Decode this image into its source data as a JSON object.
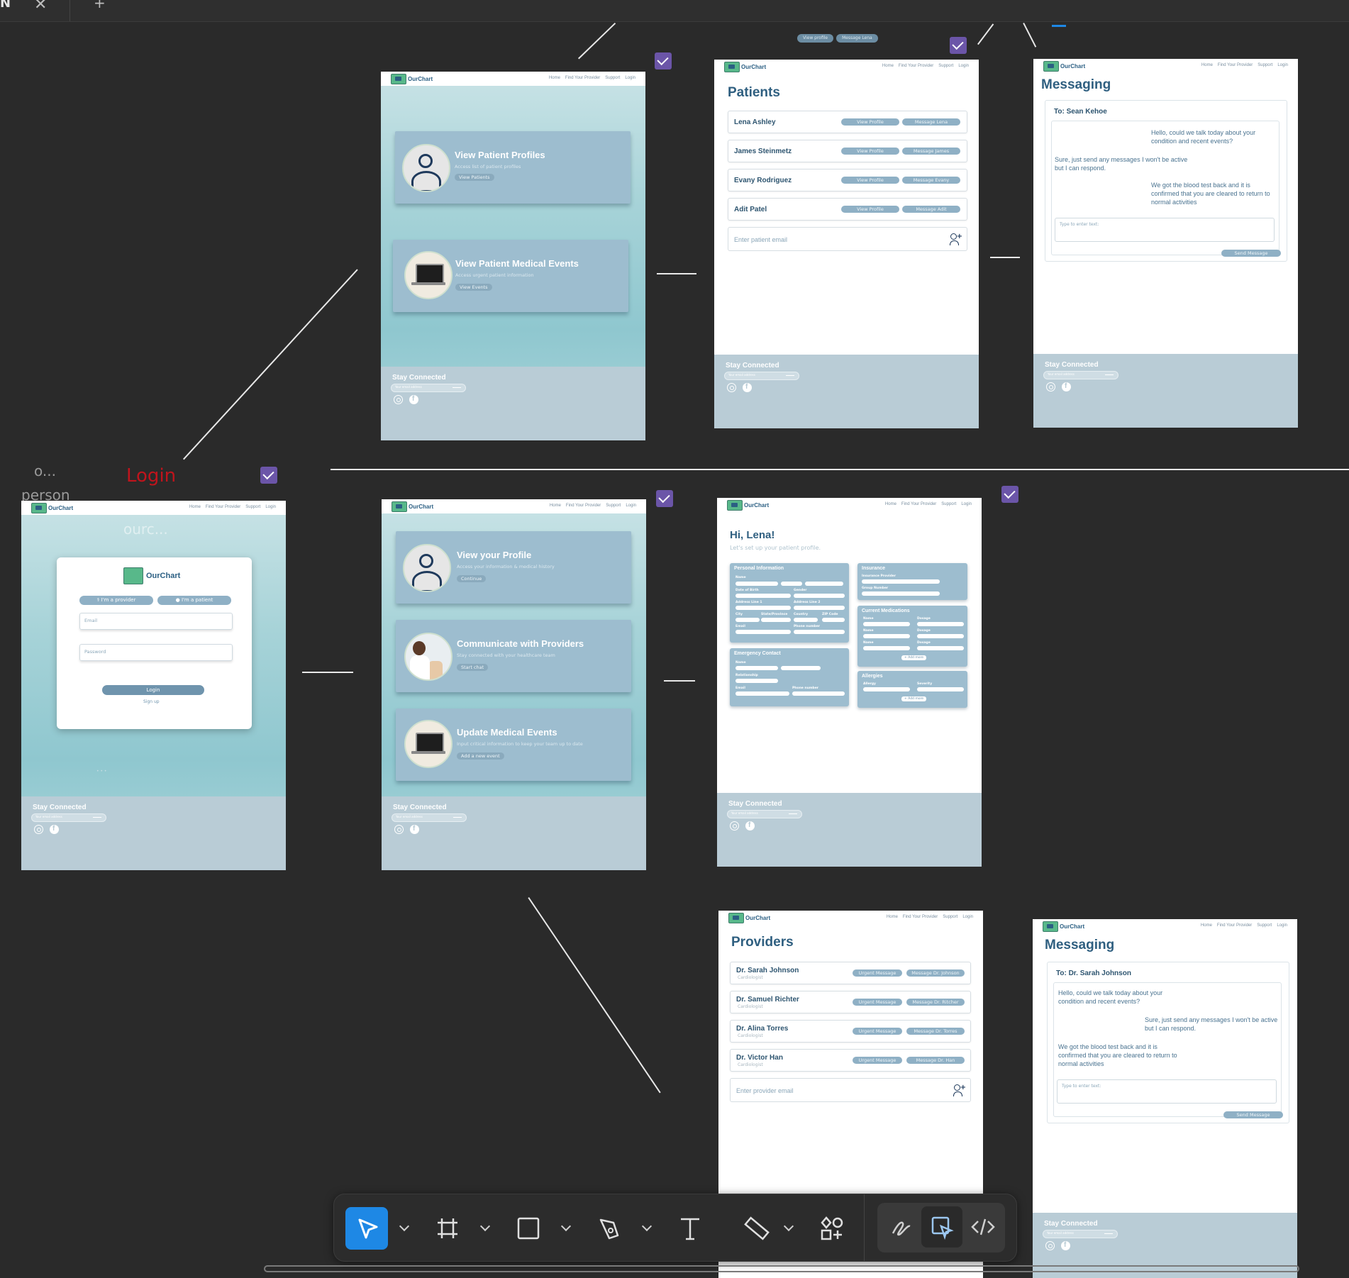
{
  "app": {
    "tab_initial": "N",
    "close_glyph": "✕",
    "add_glyph": "+"
  },
  "canvas_labels": {
    "o_label": "o...",
    "person_label": "person",
    "login_label": "Login"
  },
  "brand": {
    "name": "OurChart",
    "accent": "#2f5f80",
    "card_color": "#9dbdcf",
    "footer_color": "#b9ccd6",
    "check_color": "#6b55a8"
  },
  "nav": {
    "home": "Home",
    "find": "Find Your Provider",
    "support": "Support",
    "login": "Login"
  },
  "footer": {
    "title": "Stay Connected",
    "email_placeholder": "Your email address"
  },
  "top_chips": {
    "view_profile": "View profile",
    "message_lena": "Message Lena"
  },
  "provider_home": {
    "cards": [
      {
        "title": "View Patient Profiles",
        "subtitle": "Access list of patient profiles",
        "button": "View Patients",
        "icon": "person-icon"
      },
      {
        "title": "View Patient Medical Events",
        "subtitle": "Access urgent patient information",
        "button": "View Events",
        "icon": "laptop-icon"
      }
    ]
  },
  "patients_page": {
    "title": "Patients",
    "rows": [
      {
        "name": "Lena Ashley",
        "view": "View Profile",
        "message": "Message Lena"
      },
      {
        "name": "James Steinmetz",
        "view": "View Profile",
        "message": "Message James"
      },
      {
        "name": "Evany Rodriguez",
        "view": "View Profile",
        "message": "Message Evany"
      },
      {
        "name": "Adit Patel",
        "view": "View Profile",
        "message": "Message Adit"
      }
    ],
    "add_placeholder": "Enter patient email"
  },
  "messaging_provider": {
    "title": "Messaging",
    "to": "To: Sean Kehoe",
    "messages": [
      "Hello, could we talk today about your condition and recent events?",
      "Sure, just send any messages I won't be active but I can respond.",
      "We got the blood test back and it is confirmed that you are cleared to return to normal activities"
    ],
    "type_placeholder": "Type to enter text:",
    "send": "Send Message"
  },
  "login_page": {
    "watermark": "ourc...",
    "provider_btn": "I'm a provider",
    "patient_btn": "I'm a patient",
    "email_placeholder": "Email",
    "password_placeholder": "Password",
    "login_btn": "Login",
    "signup": "Sign up",
    "dots": "• • •"
  },
  "patient_home": {
    "cards": [
      {
        "title": "View your Profile",
        "subtitle": "Access your information & medical history",
        "button": "Continue",
        "icon": "person-icon"
      },
      {
        "title": "Communicate with Providers",
        "subtitle": "Stay connected with your healthcare team",
        "button": "Start chat",
        "icon": "doctor-icon"
      },
      {
        "title": "Update Medical Events",
        "subtitle": "Input critical information to keep your team up to date",
        "button": "Add a new event",
        "icon": "laptop-icon"
      }
    ]
  },
  "profile_setup": {
    "greeting": "Hi, Lena!",
    "subtitle": "Let's set up your patient profile.",
    "personal": "Personal Information",
    "personal_labels": [
      "Name",
      "Date of Birth",
      "Gender",
      "Address Line 1",
      "Address Line 2",
      "City",
      "State/Province",
      "Country",
      "ZIP Code",
      "Email",
      "Phone number"
    ],
    "emergency": "Emergency Contact",
    "emergency_labels": [
      "Name",
      "Relationship",
      "Email",
      "Phone number"
    ],
    "insurance": "Insurance",
    "insurance_labels": [
      "Insurance Provider",
      "Group Number"
    ],
    "medications": "Current Medications",
    "med_labels": [
      "Name",
      "Dosage"
    ],
    "allergies": "Allergies",
    "allergy_labels": [
      "Allergy",
      "Severity"
    ],
    "add_more": "+ Add more"
  },
  "providers_page": {
    "title": "Providers",
    "rows": [
      {
        "name": "Dr. Sarah Johnson",
        "role": "Cardiologist",
        "urgent": "Urgent Message",
        "message": "Message Dr. Johnson"
      },
      {
        "name": "Dr. Samuel Richter",
        "role": "Cardiologist",
        "urgent": "Urgent Message",
        "message": "Message Dr. Ritcher"
      },
      {
        "name": "Dr. Alina Torres",
        "role": "Cardiologist",
        "urgent": "Urgent Message",
        "message": "Message Dr. Torres"
      },
      {
        "name": "Dr. Victor Han",
        "role": "Cardiologist",
        "urgent": "Urgent Message",
        "message": "Message Dr. Han"
      }
    ],
    "add_placeholder": "Enter provider email"
  },
  "messaging_patient": {
    "title": "Messaging",
    "to": "To: Dr. Sarah Johnson",
    "messages": [
      "Hello, could we talk today about your condition and recent events?",
      "Sure, just send any messages I won't be active but I can respond.",
      "We got the blood test back and it is confirmed that you are cleared to return to normal activities"
    ],
    "type_placeholder": "Type to enter text:",
    "send": "Send Message"
  },
  "toolbar": {
    "tools": [
      "move-tool",
      "frame-tool",
      "rectangle-tool",
      "pen-tool",
      "text-tool",
      "ruler-tool",
      "assets-tool"
    ],
    "modes": [
      "draw-mode",
      "design-mode",
      "dev-mode"
    ],
    "active_color": "#1e88e5"
  }
}
